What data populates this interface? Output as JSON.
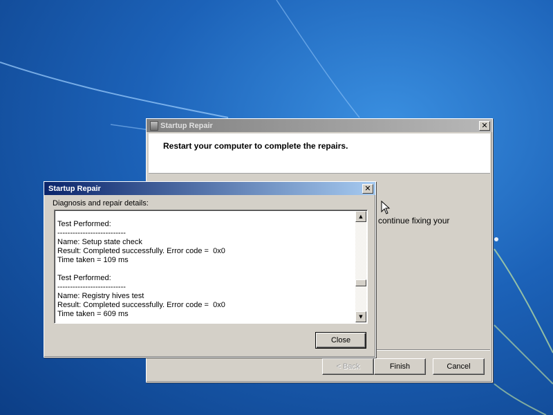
{
  "back_window": {
    "title": "Startup Repair",
    "header": "Restart your computer to complete the repairs.",
    "body_fragment": "continue fixing your",
    "buttons": {
      "back": "< Back",
      "finish": "Finish",
      "cancel": "Cancel"
    }
  },
  "details_dialog": {
    "title": "Startup Repair",
    "label": "Diagnosis and repair details:",
    "lines": [
      "Test Performed:",
      "---------------------------",
      "Name: Setup state check",
      "Result: Completed successfully. Error code =  0x0",
      "Time taken = 109 ms",
      "",
      "Test Performed:",
      "---------------------------",
      "Name: Registry hives test",
      "Result: Completed successfully. Error code =  0x0",
      "Time taken = 609 ms"
    ],
    "close_label": "Close",
    "scroll_position": 0.7
  },
  "colors": {
    "desktop_blue": "#1c62b8",
    "dialog_gray": "#d4d0c8",
    "active_title": "#0a246a"
  },
  "icons": [
    "close-icon",
    "scroll-up-arrow-icon",
    "scroll-down-arrow-icon",
    "mouse-pointer-icon",
    "window-icon"
  ]
}
